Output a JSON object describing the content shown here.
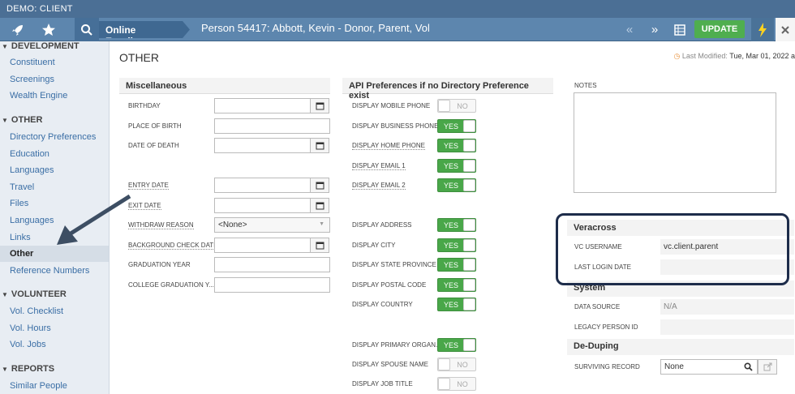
{
  "app": {
    "title": "DEMO: CLIENT"
  },
  "nav": {
    "crumb": "Online Enrollment",
    "person": "Person 54417: Abbott, Kevin - Donor, Parent, Vol",
    "update": "UPDATE"
  },
  "sidebar": {
    "development_head": "DEVELOPMENT",
    "development_items": [
      "Constituent",
      "Screenings",
      "Wealth Engine"
    ],
    "other_head": "OTHER",
    "other_items": [
      "Directory Preferences",
      "Education",
      "Languages",
      "Travel",
      "Files",
      "Languages",
      "Links",
      "Other",
      "Reference Numbers"
    ],
    "volunteer_head": "VOLUNTEER",
    "volunteer_items": [
      "Vol. Checklist",
      "Vol. Hours",
      "Vol. Jobs"
    ],
    "reports_head": "REPORTS",
    "reports_items": [
      "Similar People"
    ]
  },
  "main": {
    "title": "OTHER",
    "last_modified_label": "Last Modified:",
    "last_modified_value": "Tue, Mar 01, 2022 a"
  },
  "misc": {
    "title": "Miscellaneous",
    "fields": {
      "birthday": "BIRTHDAY",
      "place_of_birth": "PLACE OF BIRTH",
      "date_of_death": "DATE OF DEATH",
      "entry_date": "ENTRY DATE",
      "exit_date": "EXIT DATE",
      "withdraw_reason": "WITHDRAW REASON",
      "withdraw_value": "<None>",
      "background_check": "BACKGROUND CHECK DATE",
      "graduation_year": "GRADUATION YEAR",
      "college_grad": "COLLEGE GRADUATION Y..."
    }
  },
  "api": {
    "title": "API Preferences if no Directory Preference exist",
    "rows": [
      {
        "label": "DISPLAY MOBILE PHONE",
        "value": "NO",
        "on": false
      },
      {
        "label": "DISPLAY BUSINESS PHONE",
        "value": "YES",
        "on": true
      },
      {
        "label": "DISPLAY HOME PHONE",
        "value": "YES",
        "on": true
      },
      {
        "label": "DISPLAY EMAIL 1",
        "value": "YES",
        "on": true
      },
      {
        "label": "DISPLAY EMAIL 2",
        "value": "YES",
        "on": true
      },
      {
        "label": "DISPLAY ADDRESS",
        "value": "YES",
        "on": true
      },
      {
        "label": "DISPLAY CITY",
        "value": "YES",
        "on": true
      },
      {
        "label": "DISPLAY STATE PROVINCE",
        "value": "YES",
        "on": true
      },
      {
        "label": "DISPLAY POSTAL CODE",
        "value": "YES",
        "on": true
      },
      {
        "label": "DISPLAY COUNTRY",
        "value": "YES",
        "on": true
      },
      {
        "label": "DISPLAY PRIMARY ORGAN...",
        "value": "YES",
        "on": true
      },
      {
        "label": "DISPLAY SPOUSE NAME",
        "value": "NO",
        "on": false
      },
      {
        "label": "DISPLAY JOB TITLE",
        "value": "NO",
        "on": false
      }
    ]
  },
  "notes": {
    "label": "NOTES"
  },
  "veracross": {
    "title": "Veracross",
    "username_label": "VC USERNAME",
    "username_value": "vc.client.parent",
    "last_login_label": "LAST LOGIN DATE"
  },
  "system": {
    "title": "System",
    "data_source_label": "DATA SOURCE",
    "data_source_value": "N/A",
    "legacy_label": "LEGACY PERSON ID"
  },
  "deduping": {
    "title": "De-Duping",
    "surviving_label": "SURVIVING RECORD",
    "surviving_value": "None"
  }
}
